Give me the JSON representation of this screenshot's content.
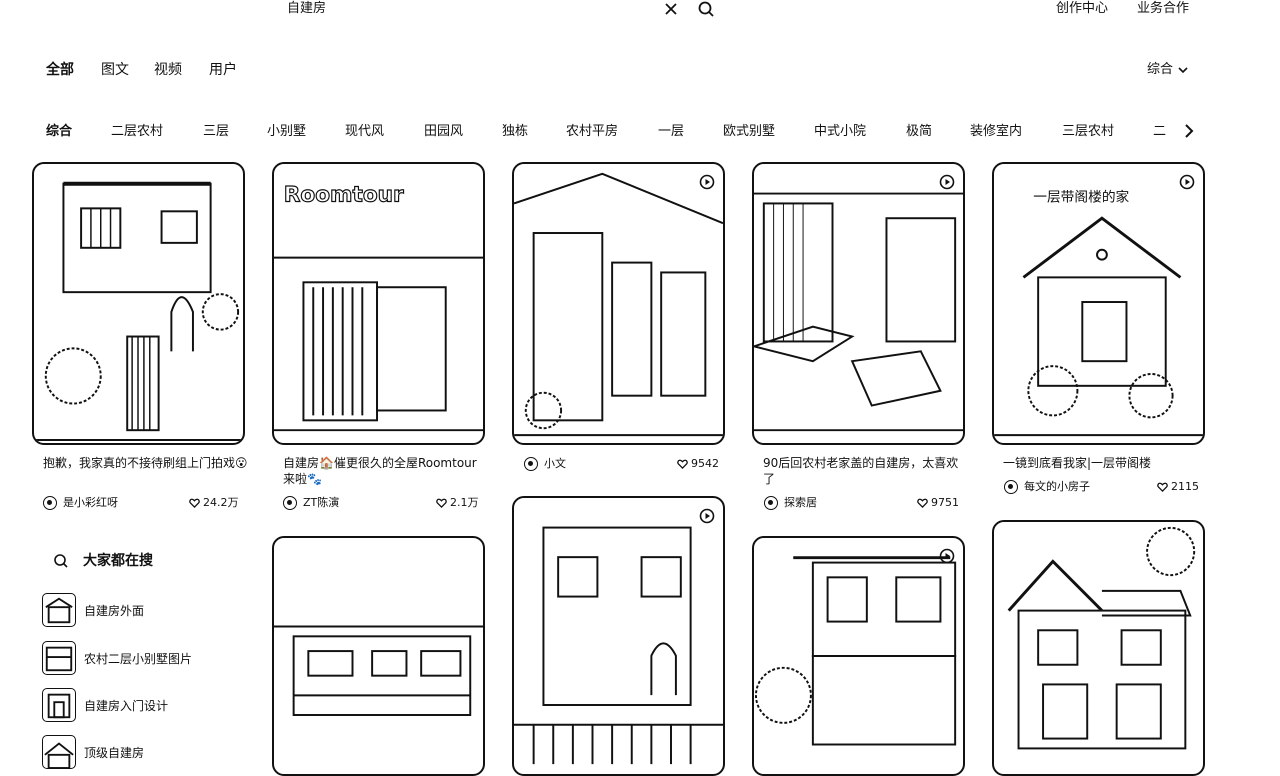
{
  "search": {
    "query": "自建房"
  },
  "top_links": {
    "creator": "创作中心",
    "business": "业务合作"
  },
  "type_tabs": [
    "全部",
    "图文",
    "视频",
    "用户"
  ],
  "sort": {
    "selected": "综合"
  },
  "tags": [
    "综合",
    "二层农村",
    "三层",
    "小别墅",
    "现代风",
    "田园风",
    "独栋",
    "农村平房",
    "一层",
    "欧式别墅",
    "中式小院",
    "极简",
    "装修室内",
    "三层农村",
    "二"
  ],
  "cards": [
    {
      "title": "抱歉，我家真的不接待刷组上门拍戏😮",
      "author": "是小彩红呀",
      "likes": "24.2万"
    },
    {
      "title": "自建房🏠催更很久的全屋Roomtour来啦🐾",
      "author": "ZT陈演",
      "likes": "2.1万",
      "overlay": "Roomtour"
    },
    {
      "title": "",
      "author": "小文",
      "likes": "9542"
    },
    {
      "title": "90后回农村老家盖的自建房，太喜欢了",
      "author": "探索居",
      "likes": "9751"
    },
    {
      "title": "一镜到底看我家|一层带阁楼",
      "author": "每文的小房子",
      "likes": "2115",
      "overlay": "一层带阁楼的家"
    },
    {
      "title": "",
      "author": "",
      "likes": ""
    },
    {
      "title": "",
      "author": "",
      "likes": ""
    },
    {
      "title": "",
      "author": "",
      "likes": ""
    },
    {
      "title": "",
      "author": "",
      "likes": ""
    }
  ],
  "hot_search": {
    "title": "大家都在搜",
    "items": [
      "自建房外面",
      "农村二层小别墅图片",
      "自建房入门设计",
      "顶级自建房"
    ]
  },
  "icons": {
    "clear": "close-icon",
    "search": "search-icon",
    "sort": "chevron-down-icon",
    "next": "chevron-right-icon",
    "like": "heart-icon",
    "hot": "search-icon",
    "video": "video-icon"
  }
}
